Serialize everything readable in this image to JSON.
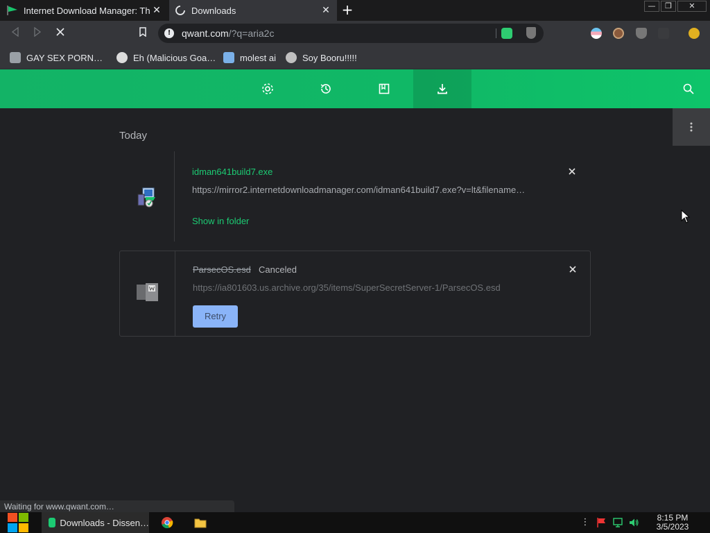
{
  "browser": {
    "tabs": [
      {
        "title": "Internet Download Manager: The",
        "icon": "idm-flag-icon"
      },
      {
        "title": "Downloads",
        "icon": "loading-spinner-icon"
      }
    ],
    "new_tab": "+",
    "window_controls": {
      "minimize": "—",
      "restore": "❐",
      "close": "✕"
    },
    "toolbar": {
      "url_host": "qwant.com",
      "url_rest": "/?q=aria2c"
    },
    "bookmarks": [
      {
        "label": "GAY SEX PORN…",
        "icon": "bookmark-favicon"
      },
      {
        "label": "Eh (Malicious Goa…",
        "icon": "globe-icon"
      },
      {
        "label": "molest ai",
        "icon": "bookmark-favicon"
      },
      {
        "label": "Soy Booru!!!!!",
        "icon": "bookmark-favicon"
      }
    ]
  },
  "appbar": {
    "nav": [
      "settings-icon",
      "history-icon",
      "bookmarks-icon",
      "downloads-icon"
    ],
    "active": "downloads-icon",
    "accent": "#13b366"
  },
  "downloads": {
    "section": "Today",
    "items": [
      {
        "filename": "idman641build7.exe",
        "url": "https://mirror2.internetdownloadmanager.com/idman641build7.exe?v=lt&filename…",
        "action": "Show in folder",
        "status": ""
      },
      {
        "filename": "ParsecOS.esd",
        "status": "Canceled",
        "url": "https://ia801603.us.archive.org/35/items/SuperSecretServer-1/ParsecOS.esd",
        "action": "Retry"
      }
    ]
  },
  "status_bubble": "Waiting for www.qwant.com…",
  "taskbar": {
    "apps": [
      {
        "label": "Downloads - Dissen…",
        "icon": "qwant-icon",
        "active": true
      },
      {
        "label": "",
        "icon": "chrome-icon"
      },
      {
        "label": "",
        "icon": "folder-icon"
      }
    ],
    "clock": {
      "time": "8:15 PM",
      "date": "3/5/2023"
    }
  }
}
